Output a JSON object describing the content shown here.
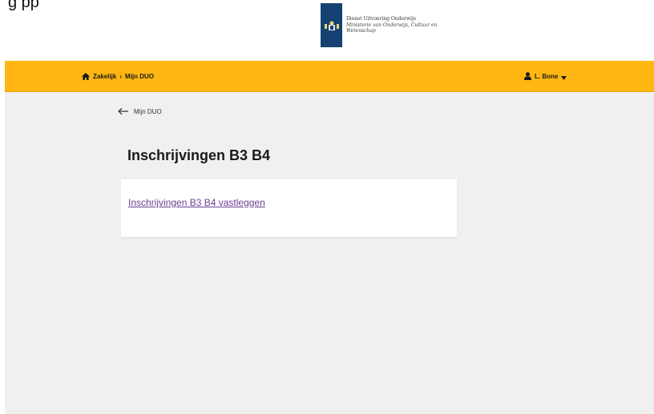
{
  "top_caption": "g        pp",
  "logo": {
    "line1": "Dienst Uitvoering Onderwijs",
    "line2": "Ministerie van Onderwijs, Cultuur en",
    "line3": "Wetenschap",
    "bar_color": "#154273"
  },
  "header": {
    "background_color": "#ffb612",
    "breadcrumb": {
      "home_label": "Zakelijk",
      "separator": "›",
      "current_label": "Mijn DUO"
    },
    "user": {
      "name": "L. Bone"
    }
  },
  "back_link": {
    "label": "Mijn DUO"
  },
  "main": {
    "title": "Inschrijvingen B3 B4",
    "card": {
      "link_label": "Inschrijvingen B3 B4 vastleggen",
      "link_color": "#6b3f91"
    }
  }
}
